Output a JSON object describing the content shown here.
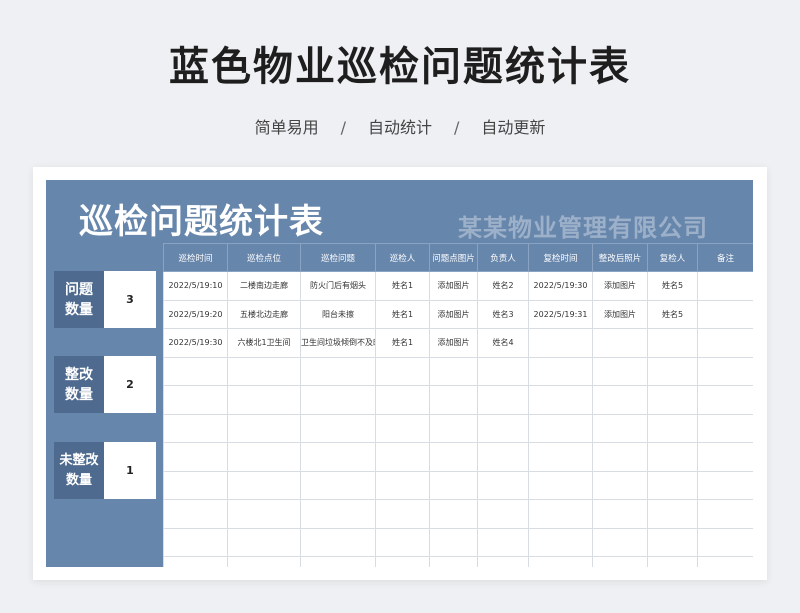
{
  "page": {
    "title": "蓝色物业巡检问题统计表",
    "subtitle": [
      "简单易用",
      "自动统计",
      "自动更新"
    ],
    "separator": "/"
  },
  "sheet": {
    "title": "巡检问题统计表",
    "company": "某某物业管理有限公司"
  },
  "stats": [
    {
      "label_lines": [
        "问题",
        "数量"
      ],
      "value": "3"
    },
    {
      "label_lines": [
        "整改",
        "数量"
      ],
      "value": "2"
    },
    {
      "label_lines": [
        "未整改",
        "数量"
      ],
      "value": "1"
    }
  ],
  "table": {
    "headers": [
      "巡检时间",
      "巡检点位",
      "巡检问题",
      "巡检人",
      "问题点图片",
      "负责人",
      "复检时间",
      "整改后照片",
      "复检人",
      "备注"
    ],
    "rows": [
      [
        "2022/5/19:10",
        "二楼南边走廊",
        "防火门后有烟头",
        "姓名1",
        "添加图片",
        "姓名2",
        "2022/5/19:30",
        "添加图片",
        "姓名5",
        ""
      ],
      [
        "2022/5/19:20",
        "五楼北边走廊",
        "阳台未擦",
        "姓名1",
        "添加图片",
        "姓名3",
        "2022/5/19:31",
        "添加图片",
        "姓名5",
        ""
      ],
      [
        "2022/5/19:30",
        "六楼北1卫生间",
        "卫生间垃圾倾倒不及时",
        "姓名1",
        "添加图片",
        "姓名4",
        "",
        "",
        "",
        ""
      ],
      [
        "",
        "",
        "",
        "",
        "",
        "",
        "",
        "",
        "",
        ""
      ],
      [
        "",
        "",
        "",
        "",
        "",
        "",
        "",
        "",
        "",
        ""
      ],
      [
        "",
        "",
        "",
        "",
        "",
        "",
        "",
        "",
        "",
        ""
      ],
      [
        "",
        "",
        "",
        "",
        "",
        "",
        "",
        "",
        "",
        ""
      ],
      [
        "",
        "",
        "",
        "",
        "",
        "",
        "",
        "",
        "",
        ""
      ],
      [
        "",
        "",
        "",
        "",
        "",
        "",
        "",
        "",
        "",
        ""
      ],
      [
        "",
        "",
        "",
        "",
        "",
        "",
        "",
        "",
        "",
        ""
      ],
      [
        "",
        "",
        "",
        "",
        "",
        "",
        "",
        "",
        "",
        ""
      ]
    ]
  }
}
